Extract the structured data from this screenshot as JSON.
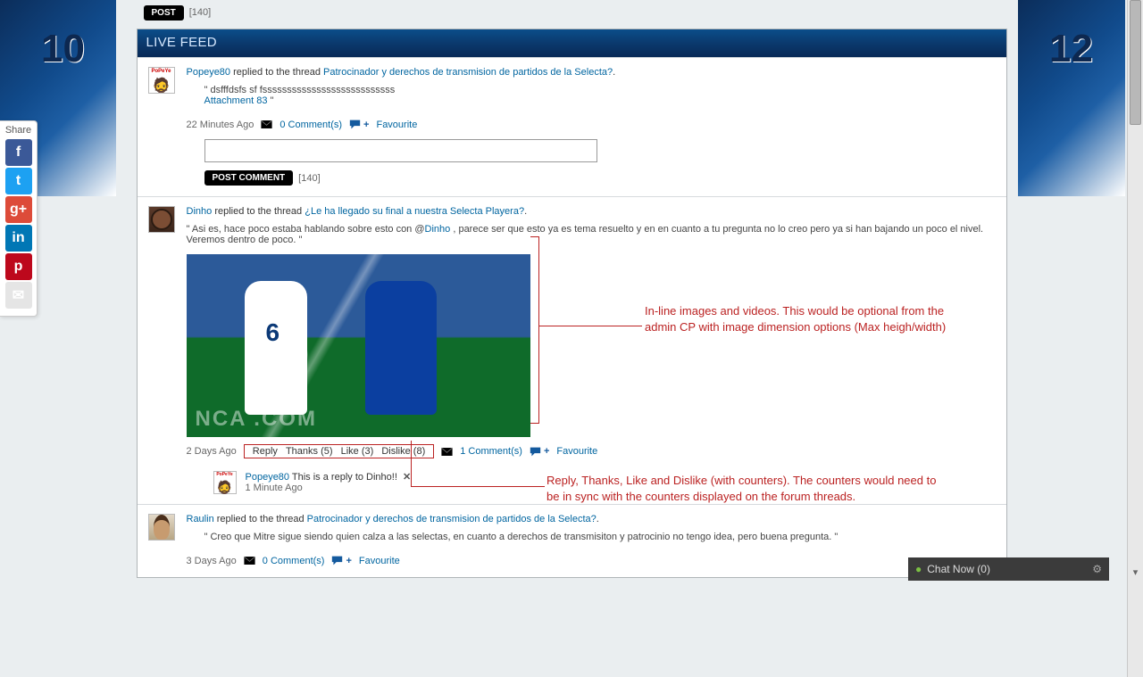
{
  "topbar": {
    "post_remaining": "[140]"
  },
  "panel": {
    "title": "LIVE FEED"
  },
  "common": {
    "replied": "replied to the thread",
    "comments0": "0 Comment(s)",
    "comments1": "1 Comment(s)",
    "favourite": "Favourite",
    "post_comment": "POST COMMENT",
    "remaining": "[140]",
    "reply": "Reply",
    "thanks": "Thanks (5)",
    "like": "Like (3)",
    "dislike": "Dislike (8)"
  },
  "feed": [
    {
      "user": "Popeye80",
      "thread": "Patrocinador y derechos de transmision de partidos de la Selecta?",
      "quote": "\" dsfffdsfs sf fsssssssssssssssssssssssssss",
      "attachment": "Attachment 83",
      "closeq": " \"",
      "time": "22 Minutes Ago"
    },
    {
      "user": "Dinho",
      "thread": "¿Le ha llegado su final a nuestra Selecta Playera?",
      "quote_pre": "\" Asi es, hace poco estaba hablando sobre esto con @",
      "quote_user": "Dinho",
      "quote_post": " , parece ser que esto ya es tema resuelto y en en cuanto a tu pregunta no lo creo pero ya si han bajando un poco el nivel. Veremos dentro de poco. \"",
      "time": "2 Days Ago",
      "nested": {
        "user": "Popeye80",
        "text": "This is a reply to Dinho!!",
        "time": "1 Minute Ago"
      }
    },
    {
      "user": "Raulin",
      "thread": "Patrocinador y derechos de transmision de partidos de la Selecta?",
      "quote": "\" Creo que Mitre sigue siendo quien calza a las selectas, en cuanto a derechos de transmisiton y patrocinio no tengo idea, pero buena pregunta. \"",
      "time": "3 Days Ago"
    }
  ],
  "annotations": {
    "a1": "In-line images and videos.  This would be optional from the admin CP with image dimension options (Max heigh/width)",
    "a2": "Reply, Thanks, Like and Dislike (with counters). The counters would need to be in sync with the counters displayed on the forum threads."
  },
  "share": {
    "label": "Share"
  },
  "chat": {
    "label": "Chat Now (0)"
  }
}
